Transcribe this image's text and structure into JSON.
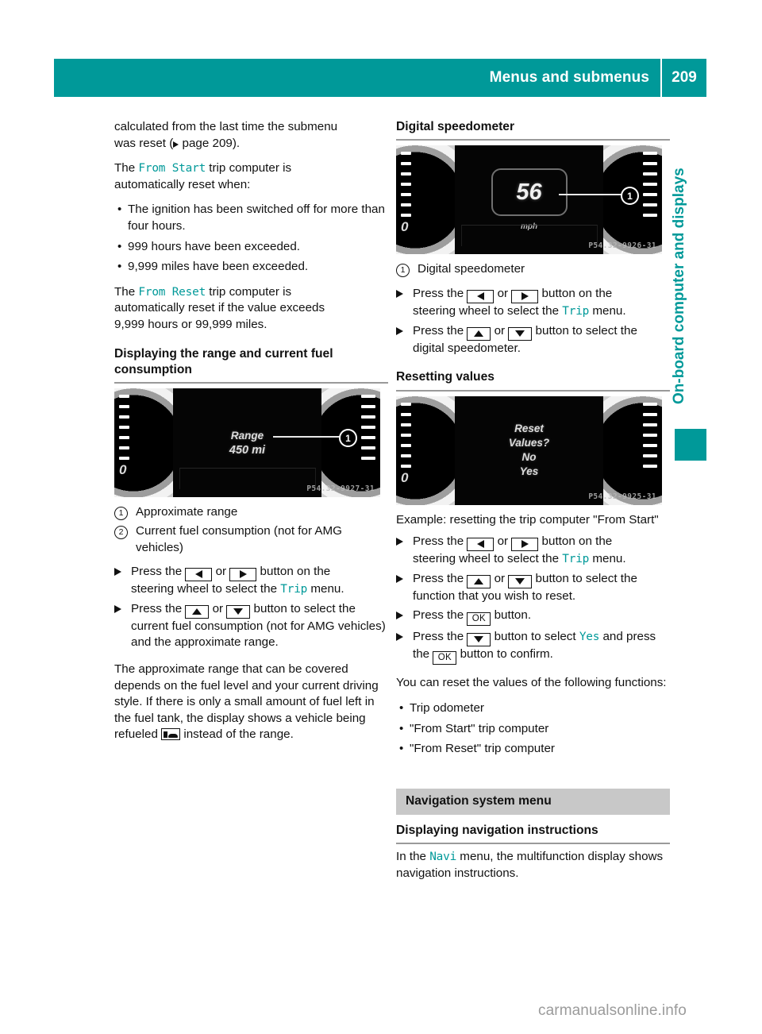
{
  "header": {
    "title": "Menus and submenus",
    "page_number": "209"
  },
  "side_tab": {
    "label": "On-board computer and displays"
  },
  "watermark": "carmanualsonline.info",
  "left_column": {
    "intro_line1": "calculated from the last time the submenu",
    "intro_line2_pre": "was reset (",
    "intro_line2_post": " page 209).",
    "from_start_pre": "The ",
    "from_start_term": "From Start",
    "from_start_post": " trip computer is",
    "from_start_line2": "automatically reset when:",
    "bullets": [
      "The ignition has been switched off for more than four hours.",
      "999 hours have been exceeded.",
      "9,999 miles have been exceeded."
    ],
    "from_reset_pre": "The ",
    "from_reset_term": "From Reset",
    "from_reset_post": " trip computer is",
    "from_reset_line2": "automatically reset if the value exceeds",
    "from_reset_line3": "9,999 hours or 99,999 miles.",
    "heading": "Displaying the range and current fuel consumption",
    "image": {
      "display_label": "Range",
      "display_value": "450 mi",
      "callout": "1",
      "photo_id": "P54.32-9927-31"
    },
    "legend": [
      {
        "mark": "1",
        "text": "Approximate range"
      },
      {
        "mark": "2",
        "text": "Current fuel consumption (not for AMG vehicles)"
      }
    ],
    "steps": [
      {
        "parts": [
          "Press the ",
          "KEY_LEFT",
          " or ",
          "KEY_RIGHT",
          " button on the steering wheel to select the ",
          "MENU_TRIP",
          " menu."
        ],
        "menu_term": "Trip"
      },
      {
        "parts": [
          "Press the ",
          "KEY_UP",
          " or ",
          "KEY_DOWN",
          " button to select the current fuel consumption (not for AMG vehicles) and the approximate range."
        ]
      }
    ],
    "step1_a": "Press the ",
    "step1_b": " or ",
    "step1_c": " button on the",
    "step1_d": "steering wheel to select the ",
    "step1_term": "Trip",
    "step1_e": " menu.",
    "step2_a": "Press the ",
    "step2_b": " or ",
    "step2_c": " button to select the current fuel consumption (not for AMG vehicles) and the approximate range.",
    "closing_para": "The approximate range that can be covered depends on the fuel level and your current driving style. If there is only a small amount of fuel left in the fuel tank, the display shows a vehicle being refueled ",
    "closing_para_tail": " instead of the range."
  },
  "right_column": {
    "speedo_heading": "Digital speedometer",
    "speedo_image": {
      "speed_value": "56",
      "speed_unit": "mph",
      "callout": "1",
      "photo_id": "P54.32-9926-31"
    },
    "speedo_legend": [
      {
        "mark": "1",
        "text": "Digital speedometer"
      }
    ],
    "speedo_step1_a": "Press the ",
    "speedo_step1_b": " or ",
    "speedo_step1_c": " button on the",
    "speedo_step1_d": "steering wheel to select the ",
    "speedo_step1_term": "Trip",
    "speedo_step1_e": " menu.",
    "speedo_step2_a": "Press the ",
    "speedo_step2_b": " or ",
    "speedo_step2_c": " button to select the digital speedometer.",
    "reset_heading": "Resetting values",
    "reset_image": {
      "line1": "Reset",
      "line2": "Values?",
      "line3": "No",
      "line4": "Yes",
      "photo_id": "P54.32-9925-31"
    },
    "reset_caption": "Example: resetting the trip computer \"From Start\"",
    "reset_step1_a": "Press the ",
    "reset_step1_b": " or ",
    "reset_step1_c": " button on the",
    "reset_step1_d": "steering wheel to select the ",
    "reset_step1_term": "Trip",
    "reset_step1_e": " menu.",
    "reset_step2_a": "Press the ",
    "reset_step2_b": " or ",
    "reset_step2_c": " button to select the function that you wish to reset.",
    "reset_step3_a": "Press the ",
    "reset_step3_key": "OK",
    "reset_step3_b": " button.",
    "reset_step4_a": "Press the ",
    "reset_step4_b": " button to select ",
    "reset_step4_term": "Yes",
    "reset_step4_c": " and press the ",
    "reset_step4_key": "OK",
    "reset_step4_d": " button to confirm.",
    "reset_list_intro": "You can reset the values of the following functions:",
    "reset_list": [
      "Trip odometer",
      "\"From Start\" trip computer",
      "\"From Reset\" trip computer"
    ],
    "nav_band": "Navigation system menu",
    "nav_heading": "Displaying navigation instructions",
    "nav_para_a": "In the ",
    "nav_para_term": "Navi",
    "nav_para_b": " menu, the multifunction display shows navigation instructions."
  },
  "colors": {
    "accent": "#009999",
    "band_gray": "#c8c8c8",
    "rule_gray": "#9a9a9a"
  }
}
